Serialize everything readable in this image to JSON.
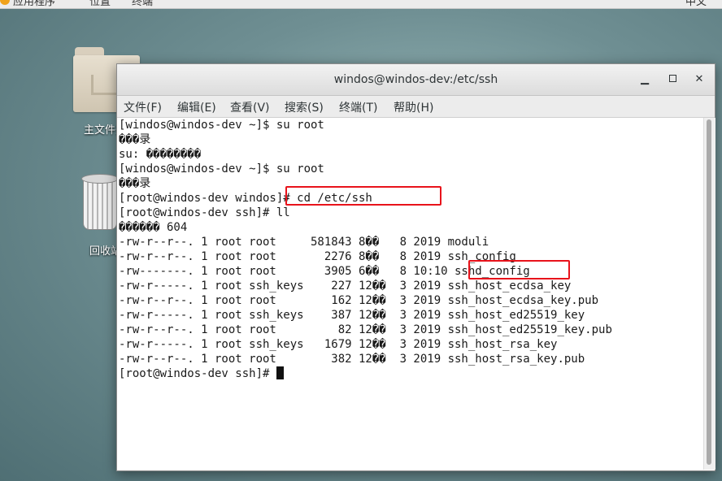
{
  "top_panel": {
    "apps": "应用程序",
    "places": "位置",
    "terminal": "终端",
    "system": "中文"
  },
  "desktop": {
    "home_label": "主文件夹",
    "trash_label": "回收站"
  },
  "window": {
    "title": "windos@windos-dev:/etc/ssh",
    "menu": [
      "文件(F)",
      "编辑(E)",
      "查看(V)",
      "搜索(S)",
      "终端(T)",
      "帮助(H)"
    ],
    "buttons": {
      "minimize": "▁",
      "close": "✕"
    }
  },
  "terminal_lines": [
    "[windos@windos-dev ~]$ su root",
    "���录",
    "su: ��������",
    "[windos@windos-dev ~]$ su root",
    "���录",
    "[root@windos-dev windos]# cd /etc/ssh",
    "[root@windos-dev ssh]# ll",
    "������ 604",
    "-rw-r--r--. 1 root root     581843 8��   8 2019 moduli",
    "-rw-r--r--. 1 root root       2276 8��   8 2019 ssh_config",
    "-rw-------. 1 root root       3905 6��   8 10:10 sshd_config",
    "-rw-r-----. 1 root ssh_keys    227 12��  3 2019 ssh_host_ecdsa_key",
    "-rw-r--r--. 1 root root        162 12��  3 2019 ssh_host_ecdsa_key.pub",
    "-rw-r-----. 1 root ssh_keys    387 12��  3 2019 ssh_host_ed25519_key",
    "-rw-r--r--. 1 root root         82 12��  3 2019 ssh_host_ed25519_key.pub",
    "-rw-r-----. 1 root ssh_keys   1679 12��  3 2019 ssh_host_rsa_key",
    "-rw-r--r--. 1 root root        382 12��  3 2019 ssh_host_rsa_key.pub"
  ],
  "prompt": "[root@windos-dev ssh]# ",
  "colors": {
    "highlight": "#e8131b"
  }
}
